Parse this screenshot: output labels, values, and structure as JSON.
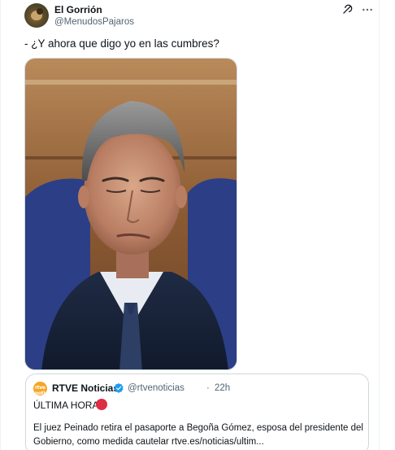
{
  "tweet": {
    "author_name": "El Gorrión",
    "author_handle": "@MenudosPajaros",
    "text": "- ¿Y ahora que digo yo en las cumbres?",
    "avatar_icon": "sparrow-avatar",
    "actions": {
      "grok_icon": "grok-icon",
      "more_icon": "more-horizontal-icon"
    }
  },
  "quoted": {
    "author_name": "RTVE Noticias",
    "author_handle": "@rtvenoticias",
    "separator": "·",
    "time": "22h",
    "avatar_label": "rtve noticias",
    "verified_icon": "verified-badge-icon",
    "headline": "ÚLTIMA HORA",
    "headline_emoji": "red-circle-emoji",
    "body_line_1": "El juez Peinado retira el pasaporte a Begoña Gómez, esposa del presidente del",
    "body_line_2": "Gobierno, como medida cautelar rtve.es/noticias/ultim..."
  },
  "colors": {
    "text_primary": "#0f1419",
    "text_secondary": "#536471",
    "border": "#cfd9de",
    "verified_blue": "#1d9bf0",
    "red_circle": "#dd2e44",
    "rtve_orange": "#f5a623"
  }
}
